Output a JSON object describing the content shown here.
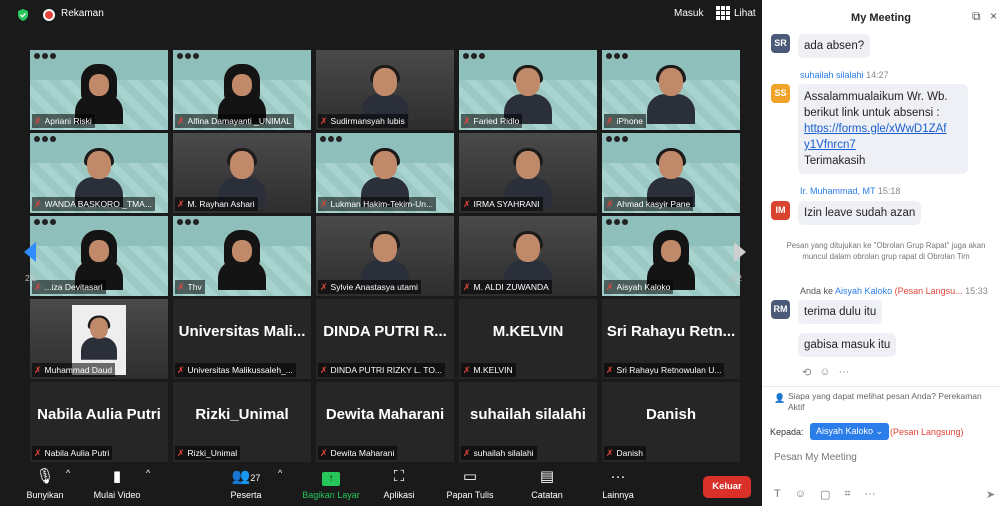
{
  "topbar": {
    "recording_label": "Rekaman",
    "sign_in": "Masuk",
    "view_label": "Lihat"
  },
  "tiles": [
    {
      "name": "Apriani Riski",
      "kind": "hijab",
      "bg": "banner",
      "active": true
    },
    {
      "name": "Alfina Damayanti _UNIMAL",
      "kind": "hijab",
      "bg": "banner"
    },
    {
      "name": "Sudirmansyah lubis",
      "kind": "person",
      "bg": "indoor"
    },
    {
      "name": "Faried Ridlo",
      "kind": "person",
      "bg": "banner"
    },
    {
      "name": "iPhone",
      "kind": "person",
      "bg": "banner"
    },
    {
      "name": "WANDA BASKORO _TMA...",
      "kind": "person",
      "bg": "banner"
    },
    {
      "name": "M. Rayhan Ashari",
      "kind": "person",
      "bg": "indoor"
    },
    {
      "name": "Lukman Hakim-Tekim-Un...",
      "kind": "person",
      "bg": "banner"
    },
    {
      "name": "IRMA SYAHRANI",
      "kind": "person",
      "bg": "indoor"
    },
    {
      "name": "Ahmad kasyir Pane",
      "kind": "person",
      "bg": "banner"
    },
    {
      "name": "...iza Devitasari",
      "kind": "hijab",
      "bg": "banner"
    },
    {
      "name": "Thv",
      "kind": "hijab",
      "bg": "banner"
    },
    {
      "name": "Sylvie Anastasya utami",
      "kind": "person",
      "bg": "indoor"
    },
    {
      "name": "M. ALDI ZUWANDA",
      "kind": "person",
      "bg": "indoor"
    },
    {
      "name": "Aisyah Kaloko",
      "kind": "hijab",
      "bg": "banner"
    },
    {
      "name": "Muhammad Daud",
      "kind": "photo",
      "bg": "dark"
    },
    {
      "name": "Universitas Malikussaleh_...",
      "big": "Universitas Mali...",
      "kind": "text"
    },
    {
      "name": "DINDA PUTRI RIZKY L. TO...",
      "big": "DINDA PUTRI R...",
      "kind": "text"
    },
    {
      "name": "M.KELVIN",
      "big": "M.KELVIN",
      "kind": "text"
    },
    {
      "name": "Sri Rahayu Retnowulan U...",
      "big": "Sri Rahayu Retn...",
      "kind": "text"
    },
    {
      "name": "Nabila Aulia Putri",
      "big": "Nabila Aulia Putri",
      "kind": "text"
    },
    {
      "name": "Rizki_Unimal",
      "big": "Rizki_Unimal",
      "kind": "text"
    },
    {
      "name": "Dewita Maharani",
      "big": "Dewita Maharani",
      "kind": "text"
    },
    {
      "name": "suhailah silalahi",
      "big": "suhailah silalahi",
      "kind": "text"
    },
    {
      "name": "Danish",
      "big": "Danish",
      "kind": "text"
    }
  ],
  "pager": {
    "left": "2/2",
    "right": "2/2"
  },
  "toolbar": {
    "mute": "Bunyikan",
    "video": "Mulai Video",
    "participants": "Peserta",
    "participants_count": "27",
    "share": "Bagikan Layar",
    "apps": "Aplikasi",
    "whiteboard": "Papan Tulis",
    "notes": "Catatan",
    "more": "Lainnya",
    "leave": "Keluar"
  },
  "chat": {
    "title": "My Meeting",
    "msg1": {
      "initials": "SR",
      "avatar_color": "#4a5a78",
      "text": "ada absen?"
    },
    "msg2": {
      "sender": "suhailah silalahi",
      "time": "14:27",
      "initials": "SS",
      "avatar_color": "#f0a22a",
      "line1": "Assalammualaikum Wr. Wb.",
      "line2": "berikut link untuk absensi :",
      "link1": "https://forms.gle/xWwD1ZAf",
      "link2": "y1Vfnrcn7",
      "line3": "Terimakasih"
    },
    "msg3": {
      "sender": "Ir. Muhammad, MT",
      "time": "15:18",
      "initials": "IM",
      "avatar_color": "#d9442e",
      "text": "Izin leave sudah azan"
    },
    "system_note": "Pesan yang ditujukan ke \"Obrolan Grup Rapat\" juga akan muncul dalam obrolan grup rapat di Obrolan Tim",
    "msg4": {
      "prefix": "Anda ke",
      "recipient": "Aisyah Kaloko",
      "private": "(Pesan Langsu...",
      "time": "15:33",
      "initials": "RM",
      "avatar_color": "#4a5a78",
      "text1": "terima dulu itu",
      "text2": "gabisa masuk itu"
    },
    "notice": "Siapa yang dapat melihat pesan Anda? Perekaman Aktif",
    "to_label": "Kepada:",
    "to_recipient": "Aisyah Kaloko",
    "to_private": "(Pesan Langsung)",
    "input_placeholder": "Pesan My Meeting"
  },
  "colors": {
    "accent": "#2b7de9",
    "share_green": "#26c65b",
    "leave_red": "#d9302a",
    "active_outline": "#e6e34b"
  }
}
